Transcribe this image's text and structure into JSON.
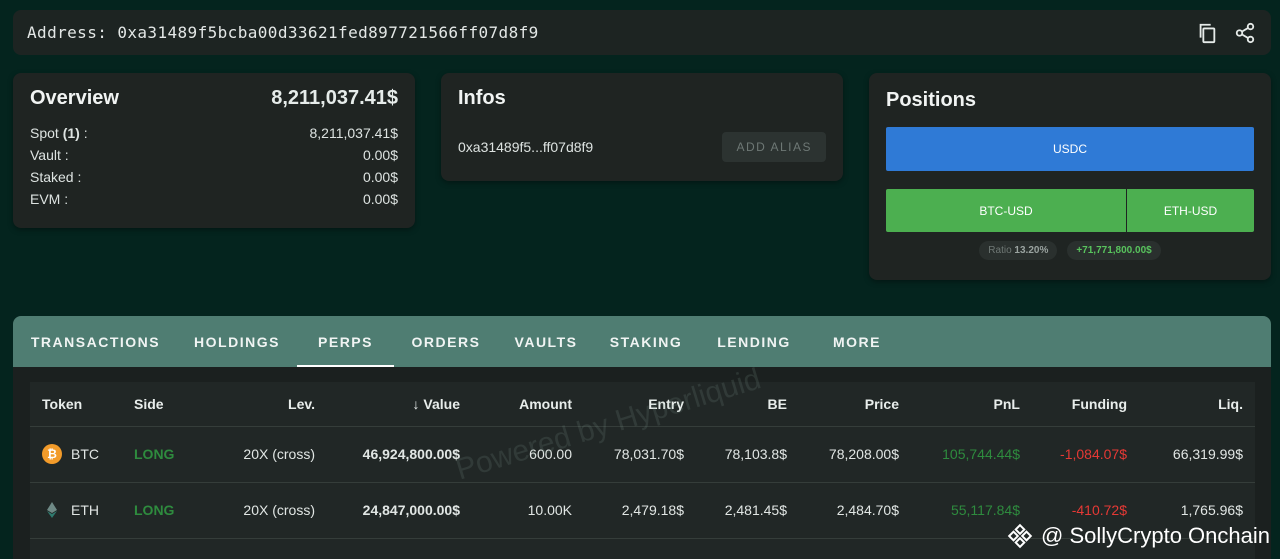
{
  "address": {
    "label": "Address:",
    "value": "0xa31489f5bcba00d33621fed897721566ff07d8f9"
  },
  "overview": {
    "title": "Overview",
    "total": "8,211,037.41$",
    "rows": [
      {
        "label": "Spot",
        "count": "(1)",
        "suffix": ":",
        "value": "8,211,037.41$"
      },
      {
        "label": "Vault :",
        "value": "0.00$"
      },
      {
        "label": "Staked :",
        "value": "0.00$"
      },
      {
        "label": "EVM :",
        "value": "0.00$"
      }
    ]
  },
  "infos": {
    "title": "Infos",
    "short_address": "0xa31489f5...ff07d8f9",
    "add_alias_label": "ADD ALIAS"
  },
  "positions": {
    "title": "Positions",
    "bar1": [
      {
        "label": "USDC",
        "color": "#2f7ad6"
      }
    ],
    "bar2": [
      {
        "label": "BTC-USD",
        "color": "#4caf50"
      },
      {
        "label": "ETH-USD",
        "color": "#4caf50"
      }
    ],
    "ratio_label": "Ratio",
    "ratio_value": "13.20%",
    "pnl_value": "+71,771,800.00$"
  },
  "tabs": [
    {
      "label": "TRANSACTIONS",
      "active": false
    },
    {
      "label": "HOLDINGS",
      "active": false
    },
    {
      "label": "PERPS",
      "active": true
    },
    {
      "label": "ORDERS",
      "active": false
    },
    {
      "label": "VAULTS",
      "active": false
    },
    {
      "label": "STAKING",
      "active": false
    },
    {
      "label": "LENDING",
      "active": false
    },
    {
      "label": "MORE",
      "active": false
    }
  ],
  "table": {
    "sort_icon": "arrow-down-icon",
    "columns": [
      "Token",
      "Side",
      "Lev.",
      "Value",
      "Amount",
      "Entry",
      "BE",
      "Price",
      "PnL",
      "Funding",
      "Liq."
    ],
    "rows": [
      {
        "icon": "bitcoin-icon",
        "token": "BTC",
        "side": "LONG",
        "lev": "20X (cross)",
        "value": "46,924,800.00$",
        "amount": "600.00",
        "entry": "78,031.70$",
        "be": "78,103.8$",
        "price": "78,208.00$",
        "pnl": "105,744.44$",
        "funding": "-1,084.07$",
        "liq": "66,319.99$"
      },
      {
        "icon": "ethereum-icon",
        "token": "ETH",
        "side": "LONG",
        "lev": "20X (cross)",
        "value": "24,847,000.00$",
        "amount": "10.00K",
        "entry": "2,479.18$",
        "be": "2,481.45$",
        "price": "2,484.70$",
        "pnl": "55,117.84$",
        "funding": "-410.72$",
        "liq": "1,765.96$"
      }
    ]
  },
  "watermark": "Powered by Hyperliquid",
  "brand": "@ SollyCrypto Onchain",
  "colors": {
    "background": "#04241e",
    "tab_bar": "#4f7d72",
    "long": "#2e8b3e",
    "negative": "#e53935"
  }
}
